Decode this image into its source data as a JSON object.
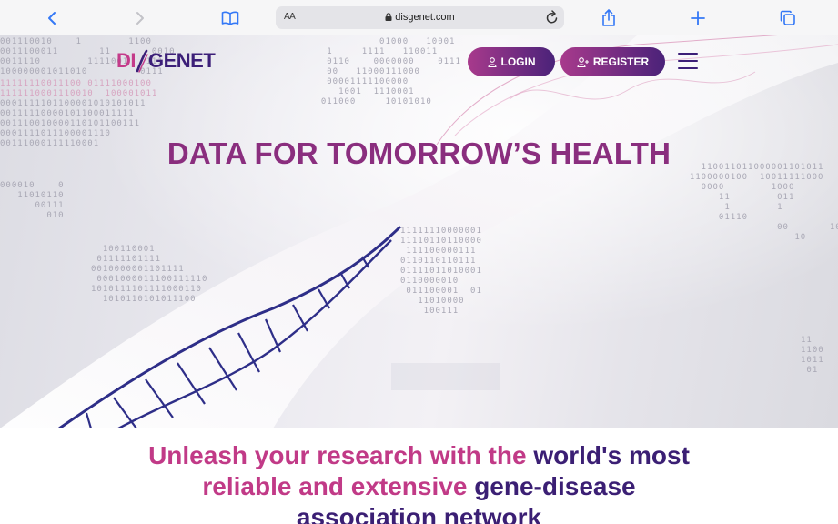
{
  "browser": {
    "text_size_label": "AA",
    "url": "disgenet.com"
  },
  "header": {
    "logo_part1": "DI",
    "logo_part2": "GENET",
    "login_label": "LOGIN",
    "register_label": "REGISTER"
  },
  "hero": {
    "title": "DATA FOR TOMORROW’S HEALTH"
  },
  "tagline": {
    "line1_a": "Unleash your research with the ",
    "line1_b": "world's most",
    "line2_a": "reliable and extensive ",
    "line2_b": "gene-disease",
    "line3": "association network"
  },
  "colors": {
    "brand_pink": "#c13a87",
    "brand_purple": "#3b1f74",
    "toolbar_blue": "#3478f6"
  }
}
